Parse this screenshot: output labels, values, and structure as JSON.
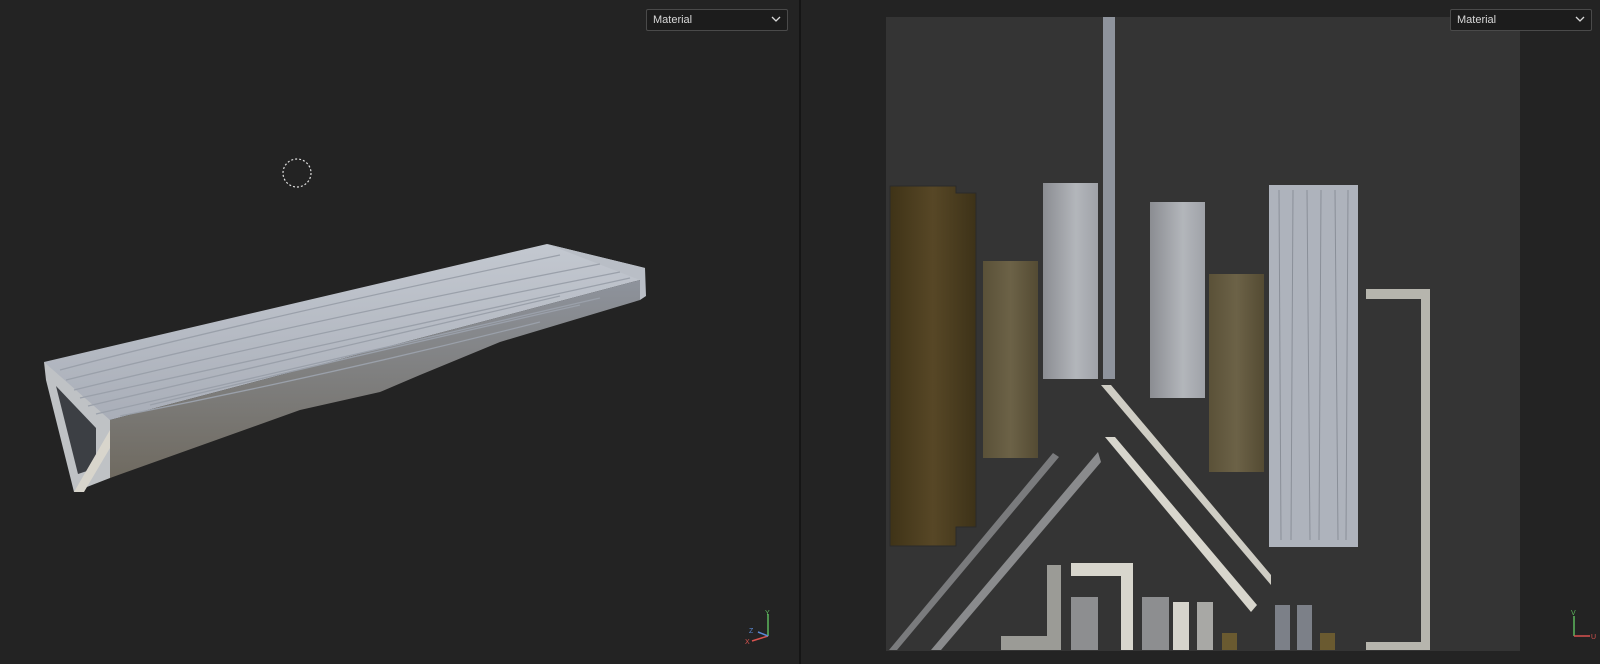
{
  "viewports": {
    "left": {
      "mode_dropdown": {
        "selected": "Material"
      },
      "axis_gizmo": {
        "labels": {
          "y": "Y",
          "z": "Z",
          "x": "X"
        }
      },
      "icons": {
        "brush_cursor": "brush-cursor-icon",
        "dropdown": "chevron-down-icon"
      }
    },
    "right": {
      "mode_dropdown": {
        "selected": "Material"
      },
      "axis_gizmo": {
        "labels": {
          "v": "V",
          "u": "U"
        }
      },
      "icons": {
        "dropdown": "chevron-down-icon"
      }
    }
  },
  "colors": {
    "background": "#232323",
    "uv_sheet": "#343434",
    "wood_dark": "#4a3d1e",
    "plank_light": "#a8adb6",
    "axis_x": "#d9534f",
    "axis_y": "#5cb85c",
    "axis_z": "#5b8ad6"
  }
}
